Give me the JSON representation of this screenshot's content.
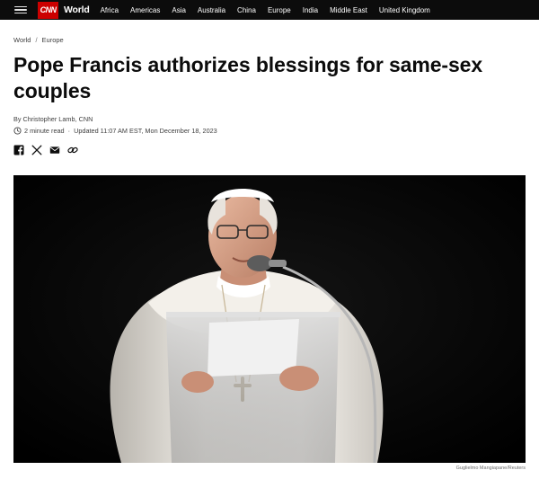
{
  "nav": {
    "logo": "CNN",
    "section": "World",
    "links": [
      "Africa",
      "Americas",
      "Asia",
      "Australia",
      "China",
      "Europe",
      "India",
      "Middle East",
      "United Kingdom"
    ]
  },
  "breadcrumb": {
    "first": "World",
    "separator": "/",
    "second": "Europe"
  },
  "headline": "Pope Francis authorizes blessings for same-sex couples",
  "byline": "By Christopher Lamb, CNN",
  "meta": {
    "read_time": "2 minute read",
    "separator": "·",
    "updated": "Updated 11:07 AM EST, Mon December 18, 2023"
  },
  "share_icons": [
    "facebook-icon",
    "x-icon",
    "email-icon",
    "link-icon"
  ],
  "photo": {
    "credit": "Guglielmo Mangiapane/Reuters"
  },
  "colors": {
    "brand": "#cc0000",
    "nav_bg": "#0c0c0c",
    "text": "#0c0c0c"
  }
}
